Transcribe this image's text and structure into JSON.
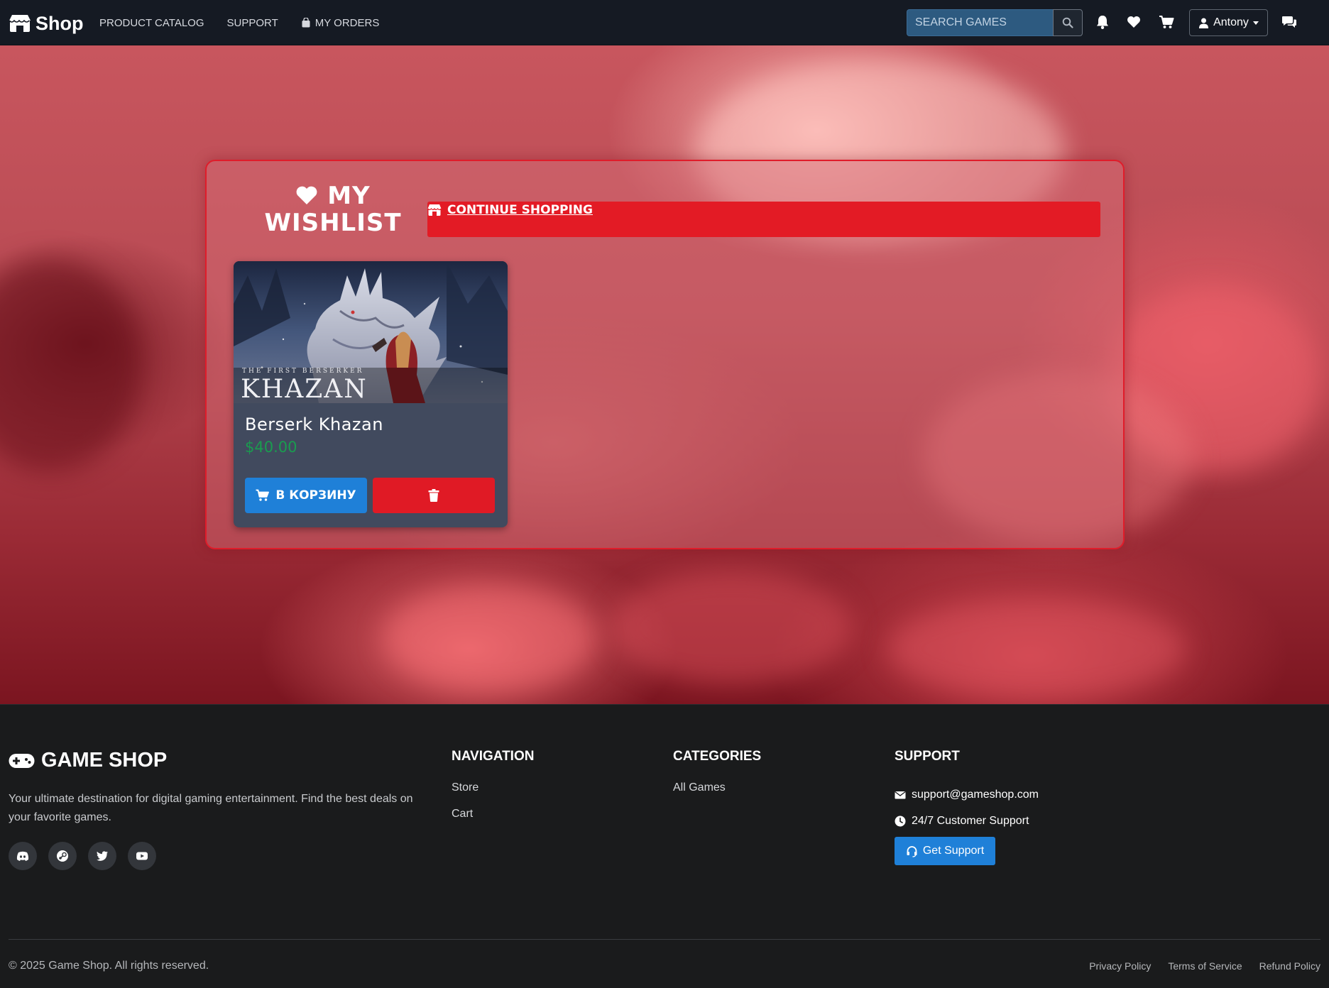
{
  "navbar": {
    "brand": "Shop",
    "links": [
      {
        "label": "PRODUCT CATALOG"
      },
      {
        "label": "SUPPORT"
      },
      {
        "label": "MY ORDERS"
      }
    ],
    "search_placeholder": "SEARCH GAMES",
    "user": "Antony"
  },
  "wishlist": {
    "title_line1": "MY",
    "title_line2": "WISHLIST",
    "continue_label": "CONTINUE SHOPPING",
    "items": [
      {
        "name": "Berserk Khazan",
        "price": "$40.00",
        "image_subtitle": "THE FIRST BERSERKER",
        "image_title": "KHAZAN",
        "add_to_cart_label": "В КОРЗИНУ"
      }
    ]
  },
  "footer": {
    "brand": "GAME SHOP",
    "description": "Your ultimate destination for digital gaming entertainment. Find the best deals on your favorite games.",
    "navigation": {
      "heading": "NAVIGATION",
      "links": [
        "Store",
        "Cart"
      ]
    },
    "categories": {
      "heading": "CATEGORIES",
      "links": [
        "All Games"
      ]
    },
    "support": {
      "heading": "SUPPORT",
      "email": "support@gameshop.com",
      "hours": "24/7 Customer Support",
      "button_label": "Get Support"
    },
    "copyright": "© 2025 Game Shop. All rights reserved.",
    "legal": [
      "Privacy Policy",
      "Terms of Service",
      "Refund Policy"
    ]
  },
  "colors": {
    "navbar_bg": "#151a23",
    "accent_red": "#e31b25",
    "accent_blue": "#1f80d8",
    "price_green": "#1a9c4f",
    "footer_bg": "#1a1b1c"
  },
  "icons": [
    "store-icon",
    "bag-icon",
    "search-icon",
    "bell-icon",
    "heart-icon",
    "cart-icon",
    "user-icon",
    "comments-icon",
    "trash-icon",
    "gamepad-icon",
    "discord-icon",
    "steam-icon",
    "twitter-icon",
    "youtube-icon",
    "envelope-icon",
    "clock-icon",
    "headset-icon"
  ]
}
